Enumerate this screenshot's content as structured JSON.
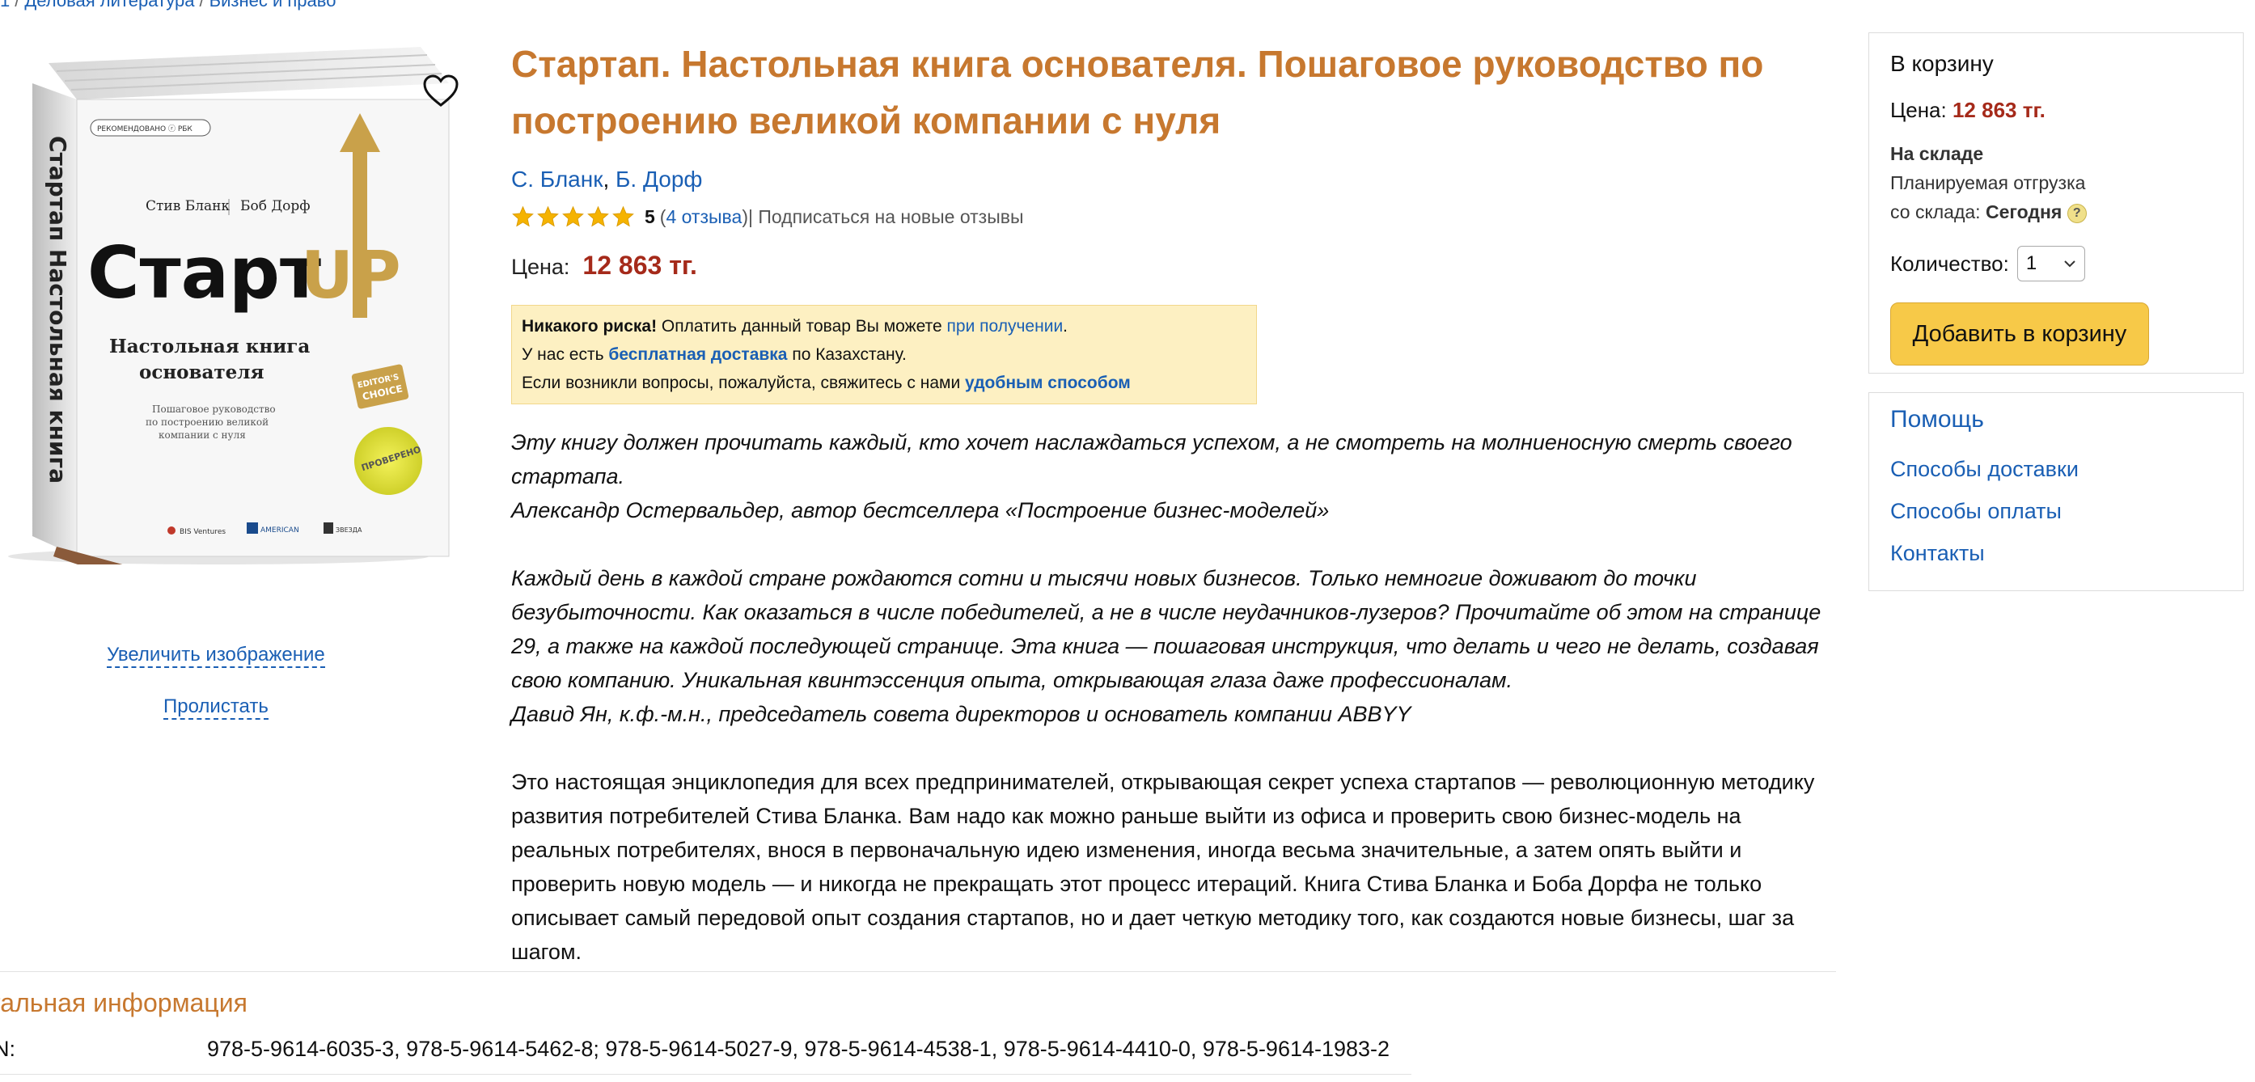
{
  "breadcrumb": {
    "items": [
      "1",
      "Деловая литература",
      "Бизнес и право"
    ]
  },
  "cover": {
    "alt": "СтартUP book cover",
    "recommended": "РЕКОМЕНДОВАНО ⓡ РБК",
    "author1": "Стив Бланк",
    "author2": "Боб Дорф",
    "logo_a": "Старт",
    "logo_b": "UP",
    "subtitle1": "Настольная книга",
    "subtitle2": "основателя",
    "small1": "Пошаговое руководство",
    "small2": "по построению великой",
    "small3": "компании с нуля",
    "badge1": "EDITOR'S",
    "badge2": "CHOICE",
    "sticker1": "ПРОВЕРЕНО",
    "spine": "Стартап Настольная книга",
    "pub1": "BIS Ventures",
    "pub2": "AMERICAN",
    "pub3": "ЗВЕЗДА",
    "zoom_label": "Увеличить изображение",
    "flip_label": "Пролистать"
  },
  "product": {
    "title": "Стартап. Настольная книга основателя. Пошаговое руководство по построению великой компании с нуля",
    "author1": "С. Бланк",
    "author_sep": ", ",
    "author2": "Б. Дорф",
    "rating": {
      "stars": 5,
      "score": "5",
      "open": "(",
      "reviews_link": "4 отзыва",
      "close": ")",
      "subscribe": " | Подписаться на новые отзывы"
    },
    "price_label": "Цена:",
    "price": "12 863 тг."
  },
  "notice": {
    "line1_bold": "Никакого риска!",
    "line1_text": " Оплатить данный товар Вы можете ",
    "line1_link": "при получении",
    "line1_end": ".",
    "line2_text": "У нас есть ",
    "line2_link": "бесплатная доставка",
    "line2_end": " по Казахстану.",
    "line3_text": "Если возникли вопросы, пожалуйста, свяжитесь с нами ",
    "line3_link": "удобным способом"
  },
  "description": {
    "p1": "Эту книгу должен прочитать каждый, кто хочет наслаждаться успехом, а не смотреть на молниеносную смерть своего стартапа.",
    "p1_attr": "Александр Остервальдер, автор бестселлера «Построение бизнес-моделей»",
    "p2": "Каждый день в каждой стране рождаются сотни и тысячи новых бизнесов. Только немногие доживают до точки безубыточности. Как оказаться в числе победителей, а не в числе неудачников-лузеров? Прочитайте об этом на странице 29, а также на каждой последующей странице. Эта книга — пошаговая инструкция, что делать и чего не делать, создавая свою компанию. Уникальная квинтэссенция опыта, открывающая глаза даже профессионалам.",
    "p2_attr": "Давид Ян, к.ф.-м.н., председатель совета директоров и основатель компании ABBYY",
    "p3": "Это настоящая энциклопедия для всех предпринимателей, открывающая секрет успеха стартапов — революционную методику развития потребителей Стива Бланка. Вам надо как можно раньше выйти из офиса и проверить свою бизнес-модель на реальных потребителях, внося в первоначальную идею изменения, иногда весьма значительные, а затем опять выйти и проверить новую модель — и никогда не прекращать этот процесс итераций. Книга Стива Бланка и Боба Дорфа не только описывает самый передовой опыт создания стартапов, но и дает четкую методику того, как создаются новые бизнесы, шаг за шагом."
  },
  "details": {
    "title": "тальная информация",
    "isbn_label": "N:",
    "isbn_value": "978-5-9614-6035-3, 978-5-9614-5462-8; 978-5-9614-5027-9, 978-5-9614-4538-1, 978-5-9614-4410-0, 978-5-9614-1983-2"
  },
  "cart": {
    "title": "В корзину",
    "price_label": "Цена: ",
    "price": "12 863 тг.",
    "stock_status": "На складе",
    "shipping_line1": "Планируемая отгрузка",
    "shipping_line2": "со склада: ",
    "shipping_when": "Сегодня",
    "help_icon": "?",
    "qty_label": "Количество:",
    "qty_value": "1",
    "add_button": "Добавить в корзину"
  },
  "help": {
    "title": "Помощь",
    "links": [
      "Способы доставки",
      "Способы оплаты",
      "Контакты"
    ]
  },
  "colors": {
    "title_orange": "#c7782f",
    "link_blue": "#1a5fb4",
    "price_red": "#a52a1a",
    "button_yellow": "#f7c948",
    "notice_bg": "#fdf0c2",
    "star_gold": "#f5b301"
  }
}
